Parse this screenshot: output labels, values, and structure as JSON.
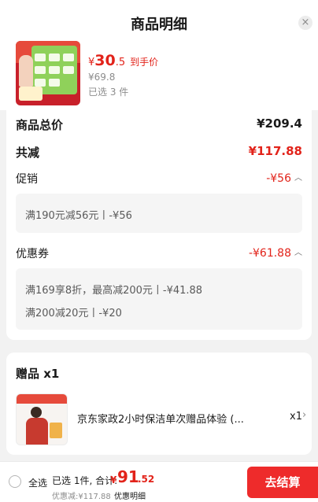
{
  "header": {
    "title": "商品明细",
    "close_symbol": "×"
  },
  "product": {
    "price_currency": "¥",
    "price_integer": "30",
    "price_decimal": ".5",
    "price_tag": "到手价",
    "original_price": "¥69.8",
    "selected_count": "已选 3 件"
  },
  "summary": {
    "total_label": "商品总价",
    "total_value": "¥209.4",
    "reduce_label": "共减",
    "reduce_value": "¥117.88",
    "promo_label": "促销",
    "promo_value": "-¥56",
    "promo_details": [
      "满190元减56元丨-¥56"
    ],
    "coupon_label": "优惠券",
    "coupon_value": "-¥61.88",
    "coupon_details": [
      "满169享8折，最高减200元丨-¥41.88",
      "满200减20元丨-¥20"
    ]
  },
  "gift": {
    "title": "赠品 x1",
    "name": "京东家政2小时保洁单次赠品体验 (...",
    "quantity": "x1"
  },
  "bottom": {
    "select_all": "全选",
    "selected_text": "已选 1件, 合计:",
    "total_currency": "¥",
    "total_integer": "91",
    "total_decimal": ".52",
    "discount_note": "优惠减:¥117.88",
    "discount_link": "优惠明细",
    "checkout_label": "去结算"
  },
  "colors": {
    "accent_red": "#e2231a",
    "checkout_red": "#ee2b2b",
    "background": "#f2f2f2"
  }
}
